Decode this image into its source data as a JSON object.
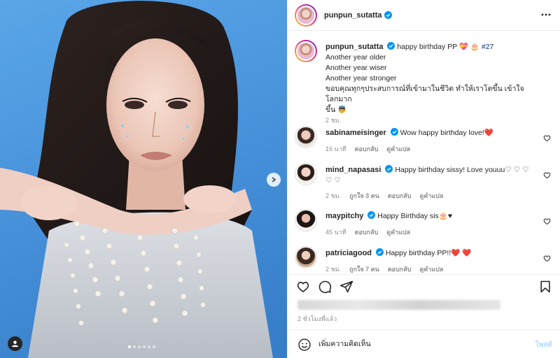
{
  "post": {
    "author": "punpun_sutatta",
    "caption_lines": [
      "happy birthday PP 💝 🎂 #27",
      "Another year older",
      "Another year wiser",
      "Another year stronger",
      "ขอบคุณทุกๆประสบการณ์ที่เข้ามาในชีวิต ทำให้เราโตขึ้น เข้าใจโลกมาก",
      "ขึ้น 👼"
    ],
    "caption_time": "2 ชม.",
    "time_ago": "2 ชั่วโมงที่แล้ว"
  },
  "comments": [
    {
      "user": "sabinameisinger",
      "text": "Wow happy birthday love!❤️",
      "text2": "",
      "time": "16 นาที",
      "likes": "",
      "reply": "ตอบกลับ",
      "translate": "ดูคำแปล"
    },
    {
      "user": "mind_napasasi",
      "text": "Happy birthday sissy! Love youuu♡ ♡ ♡",
      "text2": "♡ ♡",
      "time": "2 ชม.",
      "likes": "ถูกใจ 3 คน",
      "reply": "ตอบกลับ",
      "translate": "ดูคำแปล"
    },
    {
      "user": "maypitchy",
      "text": "Happy Birthday sis🎂♥",
      "text2": "",
      "time": "45 นาที",
      "likes": "",
      "reply": "ตอบกลับ",
      "translate": "ดูคำแปล"
    },
    {
      "user": "patriciagood",
      "text": "Happy birthday PP!!❤️ ❤️",
      "text2": "",
      "time": "2 ชม.",
      "likes": "ถูกใจ 7 คน",
      "reply": "ตอบกลับ",
      "translate": "ดูคำแปล"
    }
  ],
  "composer": {
    "placeholder": "เพิ่มความคิดเห็น",
    "post_label": "โพสต์"
  },
  "carousel": {
    "dot_count": 6,
    "active_index": 0
  },
  "colors": {
    "accent": "#0095f6",
    "verified": "#0095f6",
    "muted": "#8e8e8e",
    "post_disabled": "#b3dbff"
  }
}
